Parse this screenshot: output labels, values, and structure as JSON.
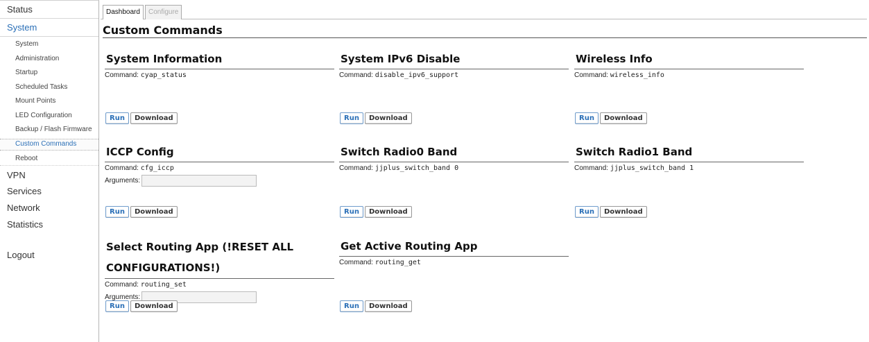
{
  "sidebar": {
    "top": [
      {
        "label": "Status"
      },
      {
        "label": "System"
      },
      {
        "label": "VPN"
      },
      {
        "label": "Services"
      },
      {
        "label": "Network"
      },
      {
        "label": "Statistics"
      },
      {
        "label": "Logout"
      }
    ],
    "sub": [
      {
        "label": "System"
      },
      {
        "label": "Administration"
      },
      {
        "label": "Startup"
      },
      {
        "label": "Scheduled Tasks"
      },
      {
        "label": "Mount Points"
      },
      {
        "label": "LED Configuration"
      },
      {
        "label": "Backup / Flash Firmware"
      },
      {
        "label": "Custom Commands"
      },
      {
        "label": "Reboot"
      }
    ]
  },
  "tabs": {
    "dashboard": "Dashboard",
    "configure": "Configure"
  },
  "page_title": "Custom Commands",
  "common": {
    "command_prefix": "Command:",
    "arguments_label": "Arguments:",
    "run": "Run",
    "download": "Download"
  },
  "commands": [
    {
      "title": "System Information",
      "command": "cyap_status"
    },
    {
      "title": "System IPv6 Disable",
      "command": "disable_ipv6_support"
    },
    {
      "title": "Wireless Info",
      "command": "wireless_info"
    },
    {
      "title": "ICCP Config",
      "command": "cfg_iccp"
    },
    {
      "title": "Switch Radio0 Band",
      "command": "jjplus_switch_band 0"
    },
    {
      "title": "Switch Radio1 Band",
      "command": "jjplus_switch_band 1"
    },
    {
      "title_line1": "Select Routing App (!RESET ALL",
      "title_line2": "CONFIGURATIONS!)",
      "command": "routing_set"
    },
    {
      "title": "Get Active Routing App",
      "command": "routing_get"
    }
  ]
}
